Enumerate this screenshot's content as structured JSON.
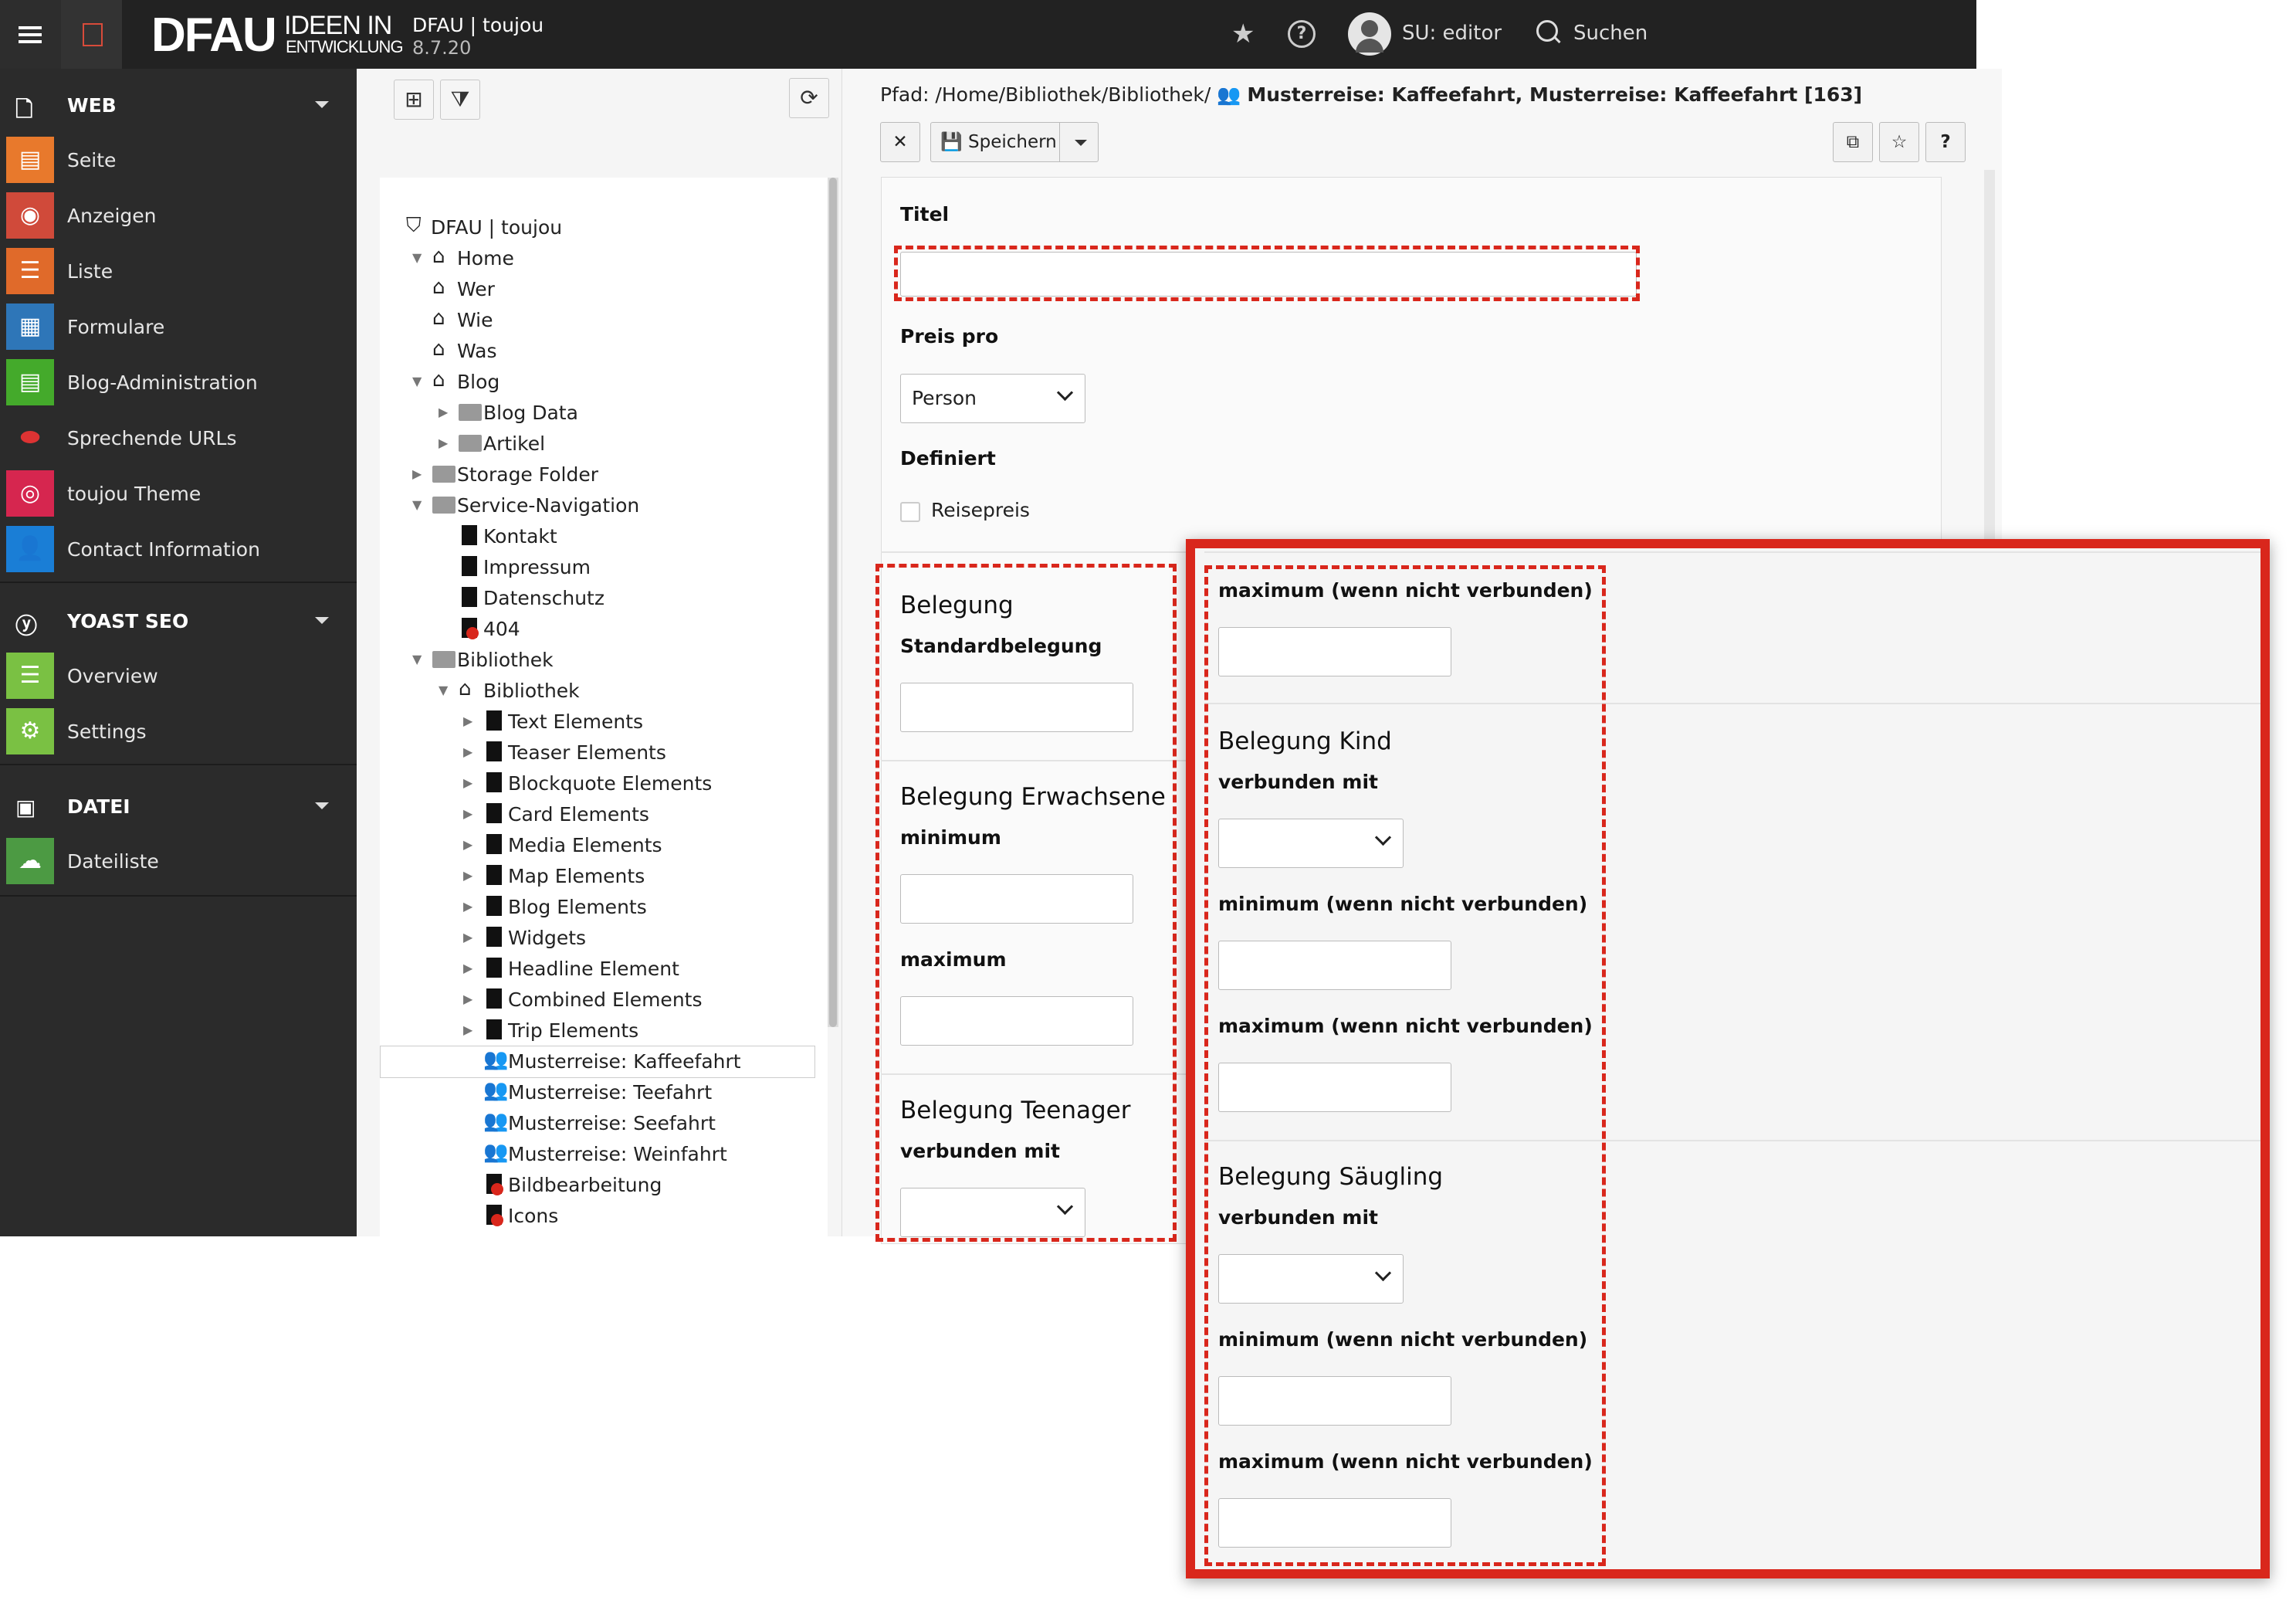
{
  "topbar": {
    "logo_main": "DFAU",
    "logo_sub1": "IDEEN IN",
    "logo_sub2": "ENTWICKLUNG",
    "site_name": "DFAU | toujou",
    "version": "8.7.20",
    "user": "SU: editor",
    "search_label": "Suchen"
  },
  "sidebar": {
    "groups": [
      {
        "title": "WEB",
        "items": [
          {
            "label": "Seite",
            "color": "#e8792c"
          },
          {
            "label": "Anzeigen",
            "color": "#d04a3a"
          },
          {
            "label": "Liste",
            "color": "#e06a2a"
          },
          {
            "label": "Formulare",
            "color": "#2e76b8"
          },
          {
            "label": "Blog-Administration",
            "color": "#44aa2b"
          },
          {
            "label": "Sprechende URLs",
            "color": "#2b2b2b"
          },
          {
            "label": "toujou Theme",
            "color": "#d6264f"
          },
          {
            "label": "Contact Information",
            "color": "#1a7ed6"
          }
        ]
      },
      {
        "title": "YOAST SEO",
        "items": [
          {
            "label": "Overview",
            "color": "#7ac143"
          },
          {
            "label": "Settings",
            "color": "#7ac143"
          }
        ]
      },
      {
        "title": "DATEI",
        "items": [
          {
            "label": "Dateiliste",
            "color": "#4c9a43"
          }
        ]
      }
    ]
  },
  "tree": {
    "root": "DFAU | toujou",
    "nodes": [
      {
        "label": "Home",
        "icon": "home-icon"
      },
      {
        "label": "Wer",
        "icon": "home-icon"
      },
      {
        "label": "Wie",
        "icon": "home-icon"
      },
      {
        "label": "Was",
        "icon": "home-icon"
      },
      {
        "label": "Blog",
        "icon": "home-icon"
      },
      {
        "label": "Blog Data",
        "icon": "folder-icon"
      },
      {
        "label": "Artikel",
        "icon": "folder-icon"
      },
      {
        "label": "Storage Folder",
        "icon": "folder-icon"
      },
      {
        "label": "Service-Navigation",
        "icon": "folder-icon"
      },
      {
        "label": "Kontakt",
        "icon": "page-icon"
      },
      {
        "label": "Impressum",
        "icon": "page-icon"
      },
      {
        "label": "Datenschutz",
        "icon": "page-icon"
      },
      {
        "label": "404",
        "icon": "page-error-icon"
      },
      {
        "label": "Bibliothek",
        "icon": "folder-icon"
      },
      {
        "label": "Bibliothek",
        "icon": "home-icon"
      },
      {
        "label": "Text Elements",
        "icon": "page-icon"
      },
      {
        "label": "Teaser Elements",
        "icon": "page-icon"
      },
      {
        "label": "Blockquote Elements",
        "icon": "page-icon"
      },
      {
        "label": "Card Elements",
        "icon": "page-icon"
      },
      {
        "label": "Media Elements",
        "icon": "page-icon"
      },
      {
        "label": "Map Elements",
        "icon": "page-icon"
      },
      {
        "label": "Blog Elements",
        "icon": "page-icon"
      },
      {
        "label": "Widgets",
        "icon": "page-icon"
      },
      {
        "label": "Headline Element",
        "icon": "page-icon"
      },
      {
        "label": "Combined Elements",
        "icon": "page-icon"
      },
      {
        "label": "Trip Elements",
        "icon": "page-icon"
      },
      {
        "label": "Musterreise: Kaffeefahrt",
        "icon": "group-icon"
      },
      {
        "label": "Musterreise: Teefahrt",
        "icon": "group-icon"
      },
      {
        "label": "Musterreise: Seefahrt",
        "icon": "group-icon"
      },
      {
        "label": "Musterreise: Weinfahrt",
        "icon": "group-icon"
      },
      {
        "label": "Bildbearbeitung",
        "icon": "page-error-icon"
      },
      {
        "label": "Icons",
        "icon": "page-error-icon"
      }
    ]
  },
  "header": {
    "path_prefix": "Pfad: /Home/Bibliothek/Bibliothek/",
    "path_title": "Musterreise: Kaffeefahrt, Musterreise: Kaffeefahrt [163]",
    "close_label": "✕",
    "save_label": "Speichern",
    "help_label": "?"
  },
  "form": {
    "titel_label": "Titel",
    "titel_value": "",
    "preis_pro_label": "Preis pro",
    "preis_pro_value": "Person",
    "definiert_label": "Definiert",
    "reisepreis_label": "Reisepreis",
    "belegung_title": "Belegung",
    "standardbelegung_label": "Standardbelegung",
    "erwachsene_title": "Belegung Erwachsene",
    "minimum_label": "minimum",
    "maximum_label": "maximum",
    "teenager_title": "Belegung Teenager",
    "verbunden_mit_label": "verbunden mit"
  },
  "zoom": {
    "max_unconnected_label": "maximum (wenn nicht verbunden)",
    "kind_title": "Belegung Kind",
    "verbunden_mit_label": "verbunden mit",
    "min_unconnected_label": "minimum (wenn nicht verbunden)",
    "saeugling_title": "Belegung Säugling"
  }
}
